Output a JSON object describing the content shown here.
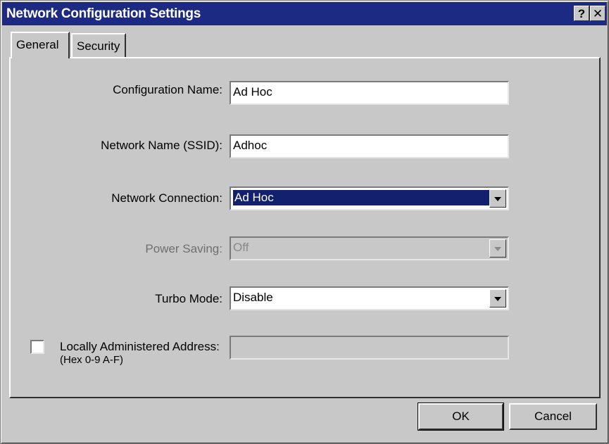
{
  "window": {
    "title": "Network Configuration Settings",
    "help_label": "?",
    "close_label": "✕"
  },
  "tabs": [
    {
      "label": "General",
      "active": true
    },
    {
      "label": "Security",
      "active": false
    }
  ],
  "form": {
    "config_name": {
      "label": "Configuration Name:",
      "value": "Ad Hoc"
    },
    "ssid": {
      "label": "Network Name (SSID):",
      "value": "Adhoc"
    },
    "network_connection": {
      "label": "Network Connection:",
      "value": "Ad Hoc"
    },
    "power_saving": {
      "label": "Power Saving:",
      "value": "Off",
      "disabled": true
    },
    "turbo_mode": {
      "label": "Turbo Mode:",
      "value": "Disable"
    },
    "laa": {
      "label_line1": "Locally Administered Address:",
      "label_line2": "(Hex 0-9 A-F)",
      "value": "",
      "checked": false
    }
  },
  "buttons": {
    "ok_label": "OK",
    "cancel_label": "Cancel"
  },
  "colors": {
    "title_bar": "#1d2a84",
    "dialog_face": "#c8c8c8",
    "selection": "#12206e"
  }
}
